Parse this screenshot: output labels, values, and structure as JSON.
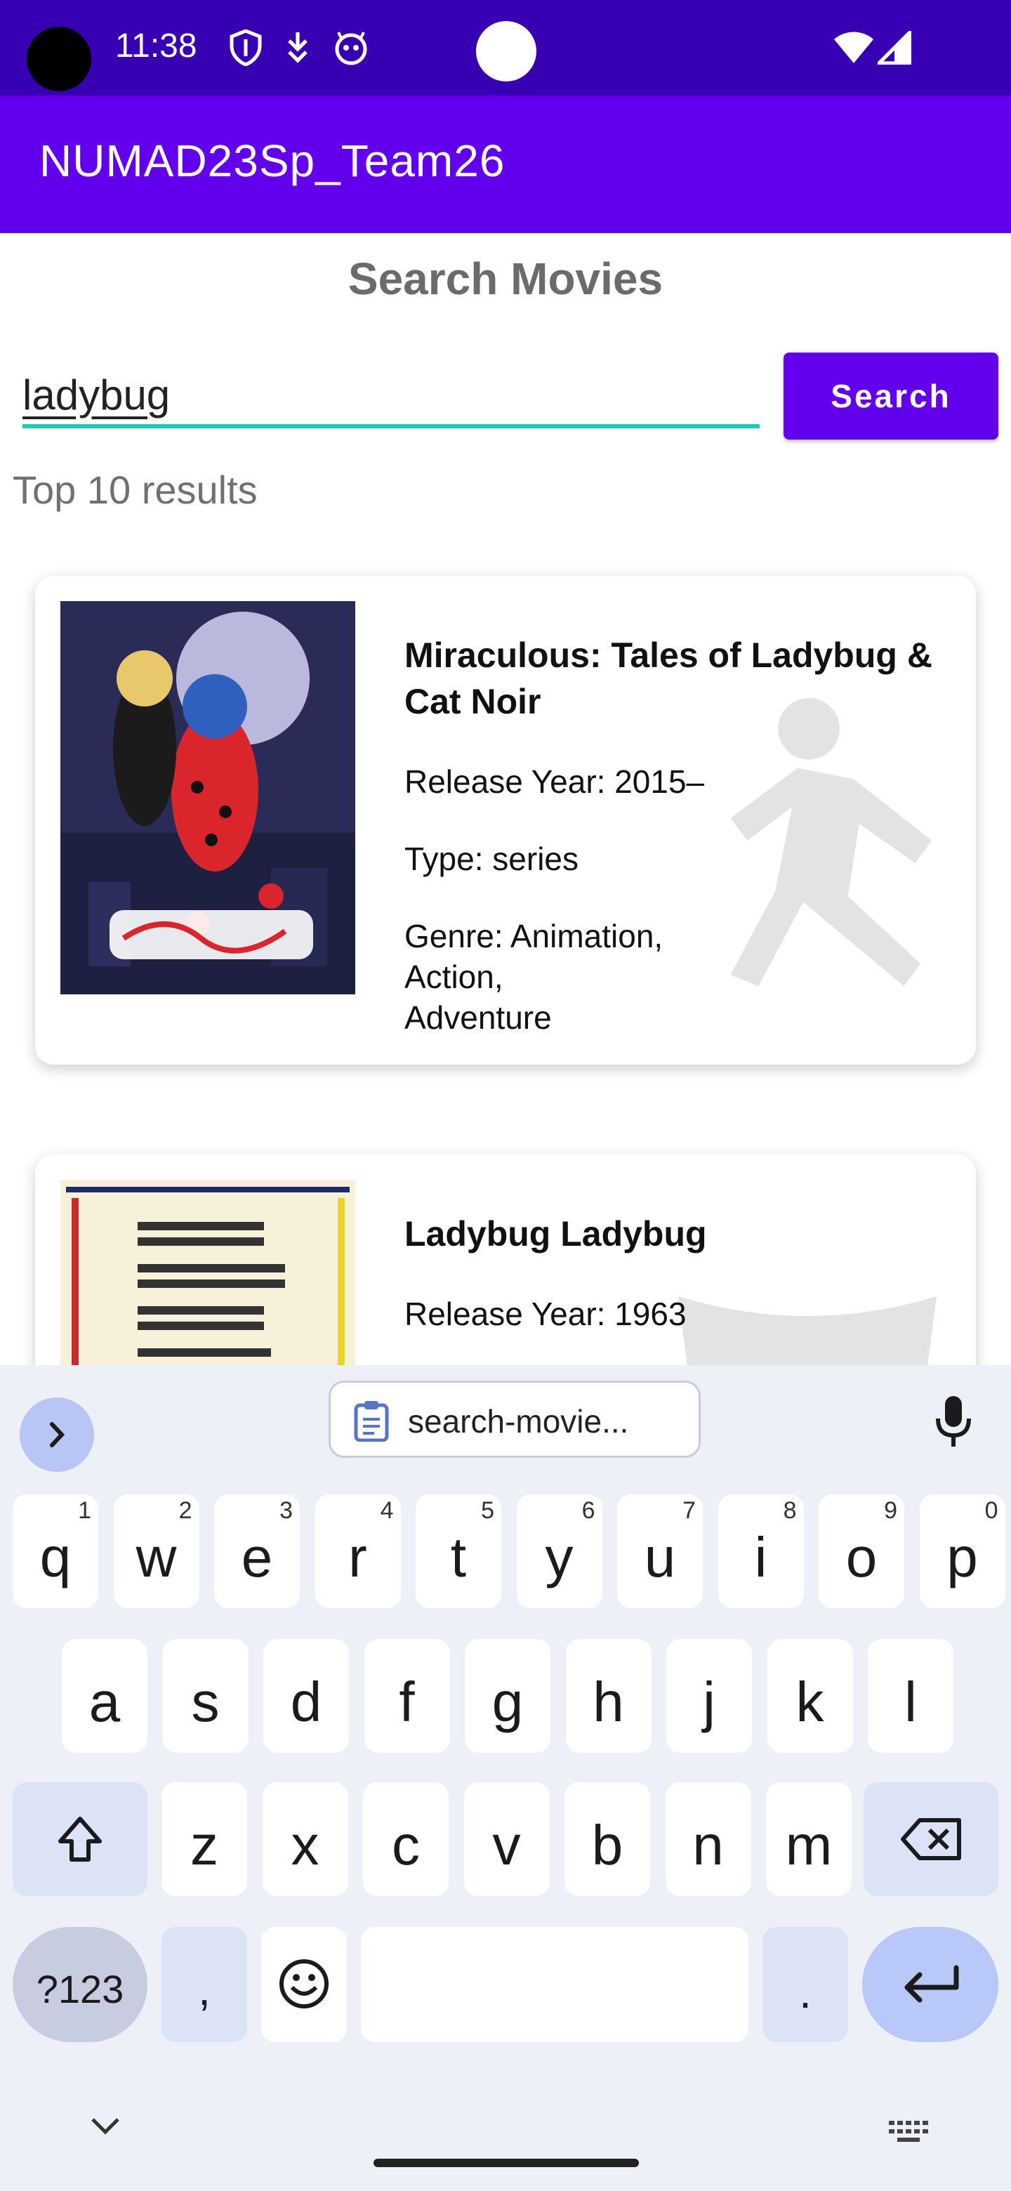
{
  "status_bar": {
    "time": "11:38",
    "icons": [
      "shield-icon",
      "download-arrow-icon",
      "android-face-icon",
      "wifi-icon",
      "signal-icon"
    ],
    "background": "#3700b3"
  },
  "app_bar": {
    "title": "NUMAD23Sp_Team26",
    "background": "#6200ee"
  },
  "page": {
    "heading": "Search Movies",
    "search_value": "ladybug",
    "search_button": "Search",
    "results_label": "Top 10 results",
    "accent_underline": "#1fc9b5"
  },
  "results": [
    {
      "title": "Miraculous: Tales of Ladybug & Cat Noir",
      "release": "Release Year: 2015–",
      "type": "Type: series",
      "genre": "Genre: Animation,\n Action,\n Adventure",
      "watermark_icon": "running-person-icon"
    },
    {
      "title": "Ladybug Ladybug",
      "release": "Release Year: 1963",
      "watermark_icon": "popcorn-bucket-icon"
    }
  ],
  "keyboard": {
    "clipboard_suggestion": "search-movie...",
    "row1": [
      {
        "k": "q",
        "n": "1"
      },
      {
        "k": "w",
        "n": "2"
      },
      {
        "k": "e",
        "n": "3"
      },
      {
        "k": "r",
        "n": "4"
      },
      {
        "k": "t",
        "n": "5"
      },
      {
        "k": "y",
        "n": "6"
      },
      {
        "k": "u",
        "n": "7"
      },
      {
        "k": "i",
        "n": "8"
      },
      {
        "k": "o",
        "n": "9"
      },
      {
        "k": "p",
        "n": "0"
      }
    ],
    "row2": [
      "a",
      "s",
      "d",
      "f",
      "g",
      "h",
      "j",
      "k",
      "l"
    ],
    "row3": [
      "z",
      "x",
      "c",
      "v",
      "b",
      "n",
      "m"
    ],
    "sym_key": "?123",
    "comma_key": ",",
    "period_key": "."
  }
}
